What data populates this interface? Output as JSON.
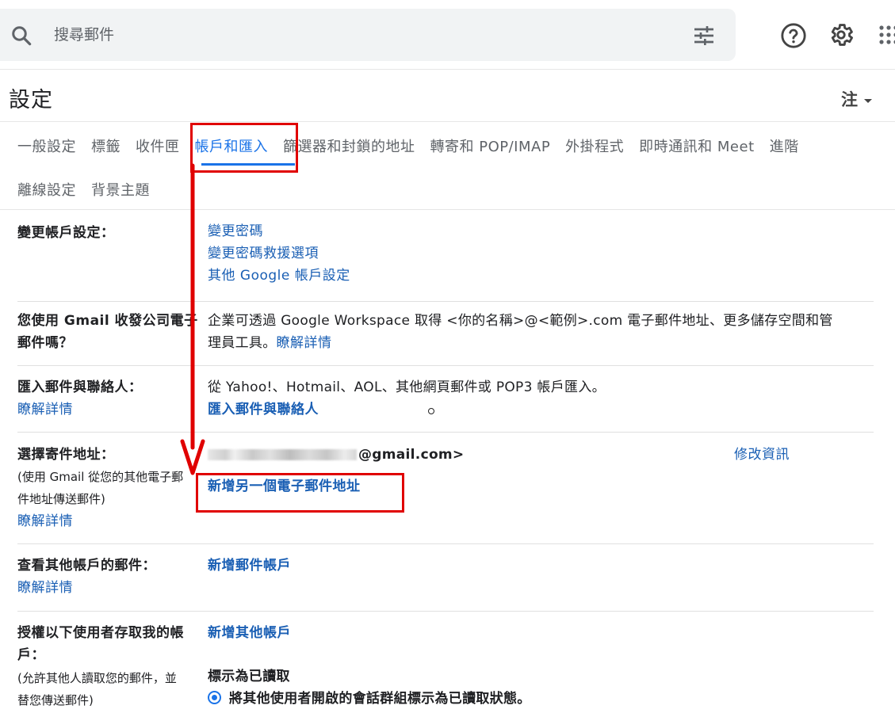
{
  "search": {
    "placeholder": "搜尋郵件"
  },
  "icons": {
    "search": "search-icon",
    "tune": "tune-icon",
    "help": "help-icon",
    "settings": "gear-icon",
    "apps": "apps-icon",
    "radio": "radio-selected-icon"
  },
  "page": {
    "title": "設定",
    "lang_label": "注"
  },
  "tabs": {
    "row1": [
      "一般設定",
      "標籤",
      "收件匣",
      "帳戶和匯入",
      "篩選器和封鎖的地址",
      "轉寄和 POP/IMAP",
      "外掛程式",
      "即時通訊和 Meet",
      "進階"
    ],
    "row2": [
      "離線設定",
      "背景主題"
    ],
    "active": "帳戶和匯入"
  },
  "sections": {
    "change_account": {
      "label": "變更帳戶設定：",
      "links": [
        "變更密碼",
        "變更密碼救援選項",
        "其他 Google 帳戶設定"
      ]
    },
    "workspace": {
      "label_line1": "您使用 Gmail 收發公司電子",
      "label_line2": "郵件嗎？",
      "text_line1": "企業可透過 Google Workspace 取得 <你的名稱>@<範例>.com 電子郵件地址、更多儲存空間和管",
      "text_line2": "理員工具。",
      "link": "瞭解詳情"
    },
    "import": {
      "label": "匯入郵件與聯絡人：",
      "sub_link": "瞭解詳情",
      "text": "從 Yahoo!、Hotmail、AOL、其他網頁郵件或 POP3 帳戶匯入。",
      "link": "匯入郵件與聯絡人"
    },
    "send_as": {
      "label": "選擇寄件地址：",
      "sub_line1": "(使用 Gmail 從您的其他電子郵",
      "sub_line2": "件地址傳送郵件)",
      "sub_link": "瞭解詳情",
      "address_suffix": "@gmail.com>",
      "edit_link": "修改資訊",
      "add_link": "新增另一個電子郵件地址"
    },
    "check_mail": {
      "label": "查看其他帳戶的郵件：",
      "sub_link": "瞭解詳情",
      "link": "新增郵件帳戶"
    },
    "grant_access": {
      "label_line1": "授權以下使用者存取我的帳",
      "label_line2": "戶：",
      "sub_line1": "(允許其他人讀取您的郵件，並",
      "sub_line2": "替您傳送郵件)",
      "link": "新增其他帳戶",
      "mark_read_title": "標示為已讀取",
      "radio_option": "將其他使用者開啟的會話群組標示為已讀取狀態。"
    }
  },
  "annotation": {
    "color": "#e00000"
  }
}
